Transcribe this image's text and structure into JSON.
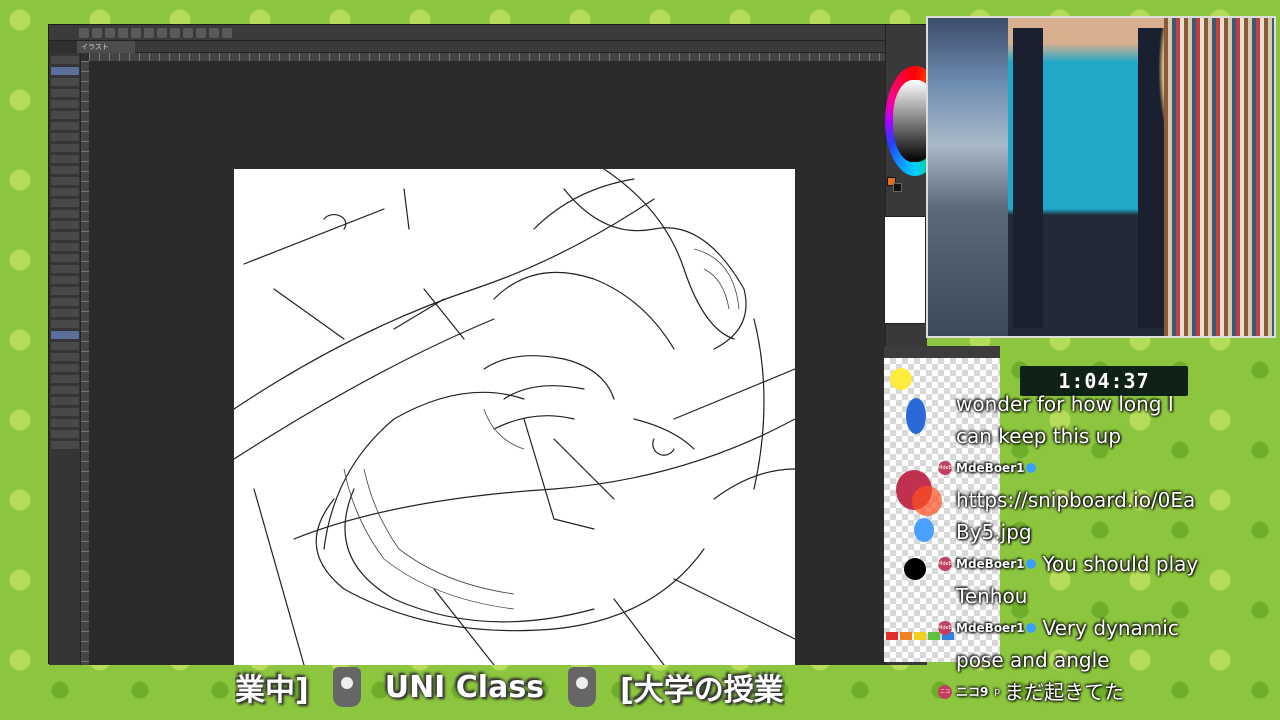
{
  "app": {
    "document_tab": "イラスト"
  },
  "timer": "1:04:37",
  "chat": {
    "messages": [
      {
        "author": "",
        "text_lines": [
          "wonder for how long I",
          "can keep this up"
        ]
      },
      {
        "author": "MdeBoer1",
        "avatar": "MdeB",
        "text_lines": [
          "https://snipboard.io/0Ea",
          "By5.jpg"
        ]
      },
      {
        "author": "MdeBoer1",
        "avatar": "MdeB",
        "inline": "You should play",
        "text_lines": [
          "Tenhou"
        ]
      },
      {
        "author": "MdeBoer1",
        "avatar": "MdeB",
        "inline": "Very dynamic",
        "text_lines": [
          "pose and angle"
        ]
      },
      {
        "author": "ニコ9",
        "author_suffix": "p",
        "avatar": "ニコ",
        "inline": "まだ起きてた",
        "text_lines": []
      }
    ]
  },
  "ticker": {
    "items": [
      "業中]",
      "UNI Class",
      "[大学の授業"
    ]
  },
  "palette_colors": [
    "#ffeb3b",
    "#2a6ad8",
    "#c23050",
    "#4aa0ff",
    "#000000",
    "#ff5020",
    "#ffa020"
  ],
  "swatches": [
    "#e03030",
    "#f08020",
    "#f0d020",
    "#60c040",
    "#3080e0"
  ]
}
